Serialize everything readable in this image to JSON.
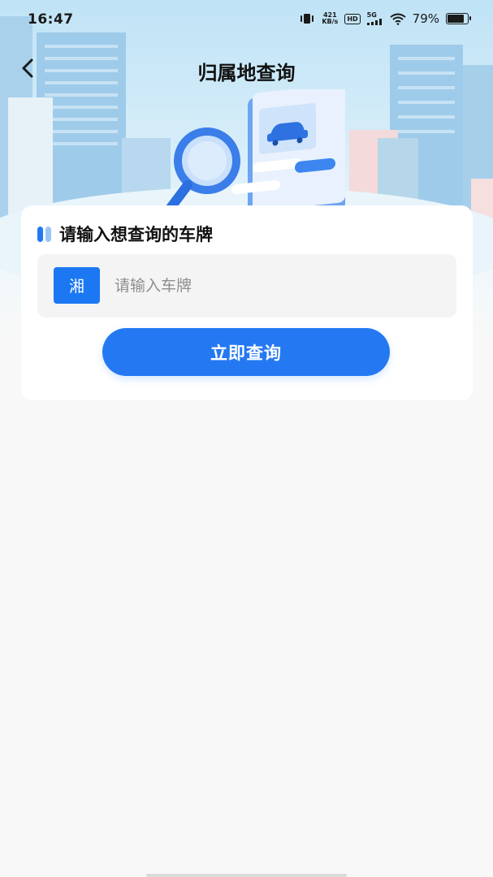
{
  "status_bar": {
    "time": "16:47",
    "net_speed_value": "421",
    "net_speed_unit": "KB/s",
    "hd_badge": "HD",
    "network_type": "5G",
    "battery_percent": "79%",
    "battery_level": 0.79
  },
  "header": {
    "title": "归属地查询",
    "back_icon": "chevron-left-icon"
  },
  "form": {
    "section_title": "请输入想查询的车牌",
    "province_prefix": "湘",
    "plate_placeholder": "请输入车牌",
    "plate_value": "",
    "submit_label": "立即查询"
  },
  "colors": {
    "primary": "#2479f3",
    "province_bg": "#1b78f2",
    "page_bg": "#f8f8f8",
    "card_bg": "#ffffff",
    "input_bg": "#f4f4f4",
    "hero_sky": "#bfe3f6"
  }
}
